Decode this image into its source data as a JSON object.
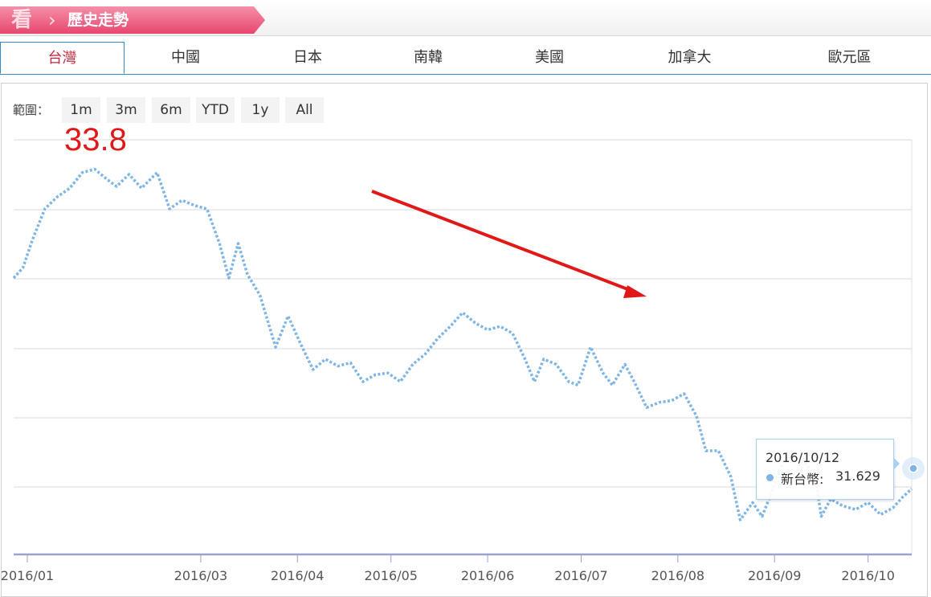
{
  "header": {
    "glyph": "看",
    "title": "歷史走勢"
  },
  "tabs": [
    {
      "label": "台灣",
      "active": true
    },
    {
      "label": "中國"
    },
    {
      "label": "日本"
    },
    {
      "label": "南韓"
    },
    {
      "label": "美國"
    },
    {
      "label": "加拿大"
    },
    {
      "label": "歐元區"
    }
  ],
  "range": {
    "label": "範圍：",
    "buttons": [
      "1m",
      "3m",
      "6m",
      "YTD",
      "1y",
      "All"
    ]
  },
  "annotation": {
    "peak_text": "33.8",
    "arrow_color": "#e01818"
  },
  "tooltip": {
    "date": "2016/10/12",
    "series": "新台幣",
    "value": "31.629"
  },
  "colors": {
    "accent": "#e7466f",
    "line": "#7eb4e6",
    "tab_active": "#c6253a",
    "tab_border": "#2e8bd1"
  },
  "chart_data": {
    "type": "line",
    "x_tick_labels": [
      "2016/01",
      "2016/03",
      "2016/04",
      "2016/05",
      "2016/06",
      "2016/07",
      "2016/08",
      "2016/09",
      "2016/10"
    ],
    "y_grid": true,
    "line_style": "dotted",
    "series": [
      {
        "name": "新台幣",
        "points": [
          [
            "2016-01-01",
            33.0
          ],
          [
            "2016-01-04",
            33.06
          ],
          [
            "2016-01-07",
            33.22
          ],
          [
            "2016-01-11",
            33.4
          ],
          [
            "2016-01-15",
            33.47
          ],
          [
            "2016-01-19",
            33.52
          ],
          [
            "2016-01-23",
            33.61
          ],
          [
            "2016-01-27",
            33.63
          ],
          [
            "2016-01-31",
            33.57
          ],
          [
            "2016-02-03",
            33.53
          ],
          [
            "2016-02-07",
            33.6
          ],
          [
            "2016-02-11",
            33.52
          ],
          [
            "2016-02-16",
            33.61
          ],
          [
            "2016-02-20",
            33.4
          ],
          [
            "2016-02-24",
            33.45
          ],
          [
            "2016-02-28",
            33.42
          ],
          [
            "2016-03-03",
            33.4
          ],
          [
            "2016-03-07",
            33.2
          ],
          [
            "2016-03-10",
            33.0
          ],
          [
            "2016-03-13",
            33.2
          ],
          [
            "2016-03-16",
            33.02
          ],
          [
            "2016-03-20",
            32.9
          ],
          [
            "2016-03-25",
            32.6
          ],
          [
            "2016-03-29",
            32.78
          ],
          [
            "2016-04-02",
            32.62
          ],
          [
            "2016-04-06",
            32.47
          ],
          [
            "2016-04-10",
            32.53
          ],
          [
            "2016-04-14",
            32.49
          ],
          [
            "2016-04-18",
            32.51
          ],
          [
            "2016-04-22",
            32.4
          ],
          [
            "2016-04-26",
            32.44
          ],
          [
            "2016-04-30",
            32.45
          ],
          [
            "2016-05-04",
            32.4
          ],
          [
            "2016-05-08",
            32.5
          ],
          [
            "2016-05-12",
            32.56
          ],
          [
            "2016-05-16",
            32.65
          ],
          [
            "2016-05-20",
            32.72
          ],
          [
            "2016-05-24",
            32.8
          ],
          [
            "2016-05-28",
            32.74
          ],
          [
            "2016-06-01",
            32.7
          ],
          [
            "2016-06-05",
            32.72
          ],
          [
            "2016-06-09",
            32.68
          ],
          [
            "2016-06-13",
            32.53
          ],
          [
            "2016-06-16",
            32.4
          ],
          [
            "2016-06-19",
            32.53
          ],
          [
            "2016-06-23",
            32.5
          ],
          [
            "2016-06-27",
            32.4
          ],
          [
            "2016-06-30",
            32.38
          ],
          [
            "2016-07-04",
            32.6
          ],
          [
            "2016-07-08",
            32.45
          ],
          [
            "2016-07-11",
            32.38
          ],
          [
            "2016-07-15",
            32.5
          ],
          [
            "2016-07-18",
            32.4
          ],
          [
            "2016-07-22",
            32.25
          ],
          [
            "2016-07-26",
            32.28
          ],
          [
            "2016-07-30",
            32.29
          ],
          [
            "2016-08-03",
            32.33
          ],
          [
            "2016-08-07",
            32.2
          ],
          [
            "2016-08-10",
            32.0
          ],
          [
            "2016-08-14",
            32.0
          ],
          [
            "2016-08-18",
            31.85
          ],
          [
            "2016-08-21",
            31.6
          ],
          [
            "2016-08-25",
            31.7
          ],
          [
            "2016-08-28",
            31.62
          ],
          [
            "2016-09-01",
            31.8
          ],
          [
            "2016-09-04",
            31.95
          ],
          [
            "2016-09-07",
            31.99
          ],
          [
            "2016-09-10",
            31.95
          ],
          [
            "2016-09-12",
            31.9
          ],
          [
            "2016-09-14",
            31.86
          ],
          [
            "2016-09-16",
            31.62
          ],
          [
            "2016-09-19",
            31.72
          ],
          [
            "2016-09-23",
            31.68
          ],
          [
            "2016-09-27",
            31.66
          ],
          [
            "2016-10-01",
            31.7
          ],
          [
            "2016-10-05",
            31.63
          ],
          [
            "2016-10-09",
            31.67
          ],
          [
            "2016-10-12",
            31.73
          ],
          [
            "2016-10-15",
            31.78
          ]
        ]
      }
    ]
  }
}
